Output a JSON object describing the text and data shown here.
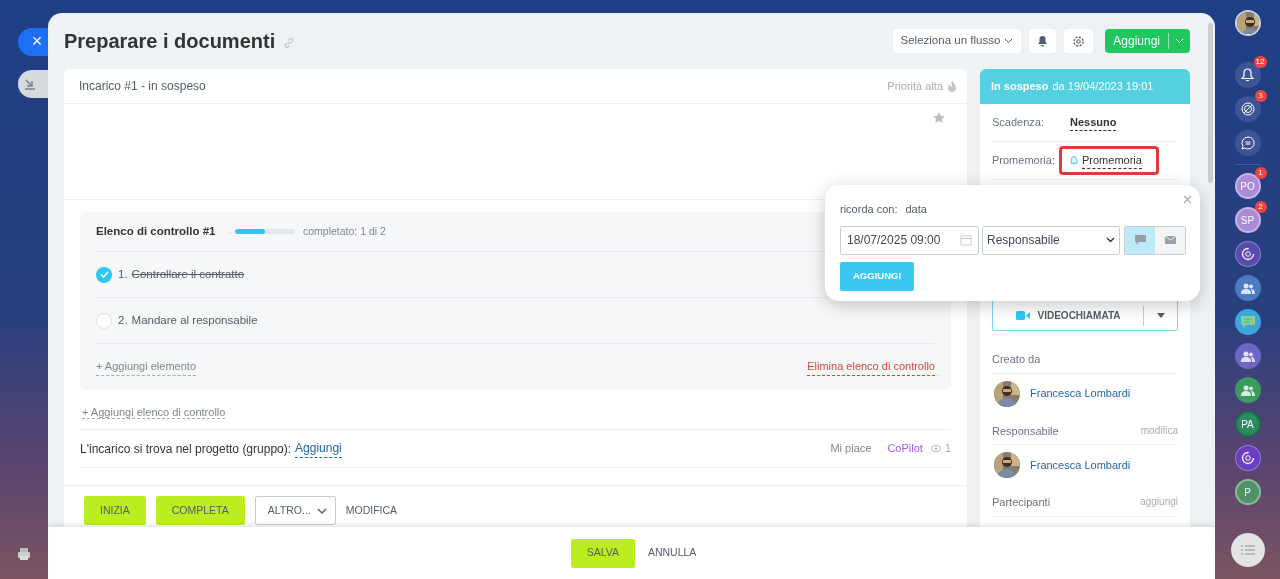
{
  "side_controls": {
    "close": "×"
  },
  "header": {
    "title": "Preparare i documenti",
    "flow_select": "Seleziona un flusso",
    "add_button": "Aggiungi"
  },
  "task": {
    "status_line": "Incarico #1 - in sospeso",
    "priority": "Priorità alta",
    "checklist": {
      "title": "Elenco di controllo #1",
      "level": 0.5,
      "progress_text": "completato: 1 di 2",
      "items": [
        {
          "number": "1.",
          "text": "Controllare il contratto",
          "checked": true
        },
        {
          "number": "2.",
          "text": "Mandare al responsabile",
          "checked": false
        }
      ],
      "add_item": "+ Aggiungi elemento",
      "delete": "Elimina elenco di controllo"
    },
    "add_checklist": "+ Aggiungi elenco di controllo",
    "project": {
      "label": "L'incarico si trova nel progetto (gruppo):",
      "link": "Aggiungi"
    },
    "like": "Mi piace",
    "copilot": "CoPilot",
    "views": "1",
    "actions": [
      {
        "label": "INIZIA",
        "kind": "primary"
      },
      {
        "label": "COMPLETA",
        "kind": "primary"
      },
      {
        "label": "ALTRO...",
        "kind": "dropdown"
      },
      {
        "label": "MODIFICA",
        "kind": "link"
      }
    ]
  },
  "status_panel": {
    "status": "In sospeso",
    "since": "da 19/04/2023 19:01",
    "fields": [
      {
        "kind": "date",
        "label": "Scadenza:",
        "value": "Nessuno",
        "highlighted": false
      },
      {
        "kind": "reminder",
        "label": "Promemoria:",
        "value": "Promemoria",
        "highlighted": true
      }
    ],
    "video_call": "VIDEOCHIAMATA",
    "people": [
      {
        "title": "Creato da",
        "name": "Francesca Lombardi"
      },
      {
        "title": "Responsabile",
        "action": "modifica",
        "name": "Francesca Lombardi"
      },
      {
        "title": "Partecipanti",
        "action": "aggiungi"
      }
    ]
  },
  "reminder_popup": {
    "label": "ricorda con:",
    "mode": "data",
    "date": "18/07/2025 09:00",
    "recipient": "Responsabile",
    "channels": [
      {
        "kind": "chat",
        "selected": true
      },
      {
        "kind": "email",
        "selected": false
      }
    ],
    "add_button": "AGGIUNGI"
  },
  "footer": {
    "save": "SALVA",
    "cancel": "ANNULLA"
  },
  "right_bar": [
    {
      "kind": "avatar"
    },
    {
      "kind": "bell",
      "badge": "12"
    },
    {
      "kind": "target",
      "badge": "3"
    },
    {
      "kind": "chat"
    },
    {
      "kind": "divider"
    },
    {
      "kind": "initials",
      "text": "PO",
      "badge": "1",
      "color": "#a98bd6"
    },
    {
      "kind": "initials",
      "text": "SP",
      "badge": "2",
      "color": "#a98bd6"
    },
    {
      "kind": "swirl",
      "color": "#5a4bb0"
    },
    {
      "kind": "group",
      "color": "#4b7cc0"
    },
    {
      "kind": "message",
      "color": "#3aa6dc"
    },
    {
      "kind": "group",
      "color": "#6d66c4"
    },
    {
      "kind": "group",
      "color": "#3d9a5e"
    },
    {
      "kind": "hexagon",
      "text": "PA",
      "color": "#2c8c62"
    },
    {
      "kind": "swirl",
      "color": "#6a3fc2"
    },
    {
      "kind": "initials",
      "text": "P",
      "color": "#4f9468"
    },
    {
      "kind": "menu"
    }
  ]
}
